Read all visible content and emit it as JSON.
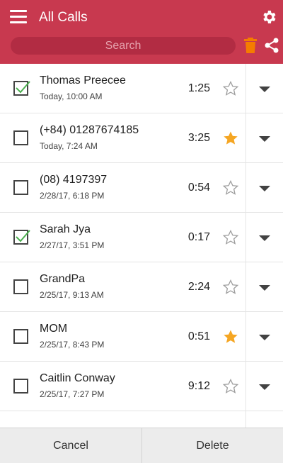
{
  "header": {
    "title": "All Calls",
    "search_placeholder": "Search",
    "color": "#c8394f"
  },
  "calls": [
    {
      "name": "Thomas Preecee",
      "time": "Today, 10:00 AM",
      "duration": "1:25",
      "checked": true,
      "starred": false
    },
    {
      "name": "(+84) 01287674185",
      "time": "Today, 7:24 AM",
      "duration": "3:25",
      "checked": false,
      "starred": true
    },
    {
      "name": "(08) 4197397",
      "time": "2/28/17, 6:18 PM",
      "duration": "0:54",
      "checked": false,
      "starred": false
    },
    {
      "name": "Sarah Jya",
      "time": "2/27/17, 3:51 PM",
      "duration": "0:17",
      "checked": true,
      "starred": false
    },
    {
      "name": "GrandPa",
      "time": "2/25/17, 9:13 AM",
      "duration": "2:24",
      "checked": false,
      "starred": false
    },
    {
      "name": "MOM",
      "time": "2/25/17, 8:43 PM",
      "duration": "0:51",
      "checked": false,
      "starred": true
    },
    {
      "name": "Caitlin Conway",
      "time": "2/25/17, 7:27 PM",
      "duration": "9:12",
      "checked": false,
      "starred": false
    }
  ],
  "actions": {
    "cancel_label": "Cancel",
    "delete_label": "Delete"
  },
  "colors": {
    "check": "#4caf50",
    "star_filled": "#f5a623",
    "trash": "#f57c00"
  }
}
